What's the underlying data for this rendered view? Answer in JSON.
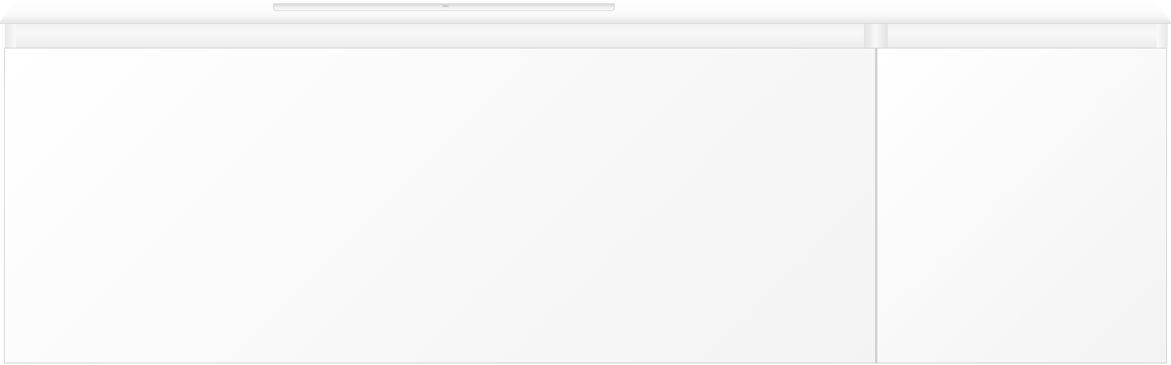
{
  "scene": {
    "subject": "wall-hung-vanity-unit",
    "colors": {
      "background": "#ffffff",
      "cabinet": "#f7f7f7",
      "edge": "#d4d4d4",
      "basin": "#ececec"
    },
    "drawers": [
      {
        "id": "left-drawer"
      },
      {
        "id": "right-drawer"
      }
    ]
  }
}
